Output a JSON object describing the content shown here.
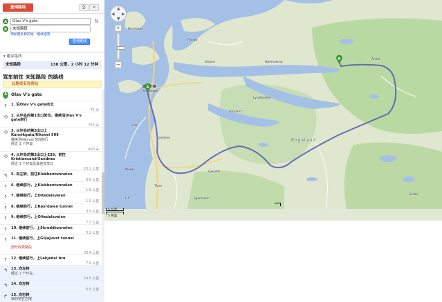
{
  "toolbar": {
    "route_tab": "查询路线",
    "print_icon": "print-icon",
    "link_icon": "link-icon"
  },
  "waypoints": {
    "a_marker": "A",
    "a_value": "Olav V's gate",
    "b_marker": "B",
    "b_value": "未知路段",
    "add_destination": "添加更多目的地 - 路线选项",
    "search_button": "查询路线"
  },
  "route": {
    "suggested_header": "建议路线",
    "summary_name": "未知路段",
    "summary_stats": "138 公里，2 小时 12 分钟",
    "title": "驾车前往 未知路段 的路线",
    "toll_notice": "此路线有收费站",
    "start_marker": "A",
    "start_label": "Olav V's gate"
  },
  "steps": [
    {
      "text": "1. 沿Olav V's gate向北",
      "sub": "",
      "dist": "75 米",
      "icon": "straight-arrow-icon"
    },
    {
      "text": "2. 从环岛的第1出口驶出，继续沿Olav V's gate前行",
      "sub": "",
      "dist": "750 米",
      "icon": "roundabout-icon"
    },
    {
      "text": "3. 从环岛的第3出口上Kannikgata/Riksvei 509",
      "sub": "继续沿Riksvei 509前行\n经过 1 个环岛",
      "dist": "400 米",
      "icon": "roundabout-icon"
    },
    {
      "text": "4. 从环岛的第2出口上E39，前往Kristiansand/Sandnes",
      "sub": "经过 3 个环岛及其他交叉口",
      "dist": "20.2 公里",
      "icon": "roundabout-icon"
    },
    {
      "text": "5. 向左转，前往Klubbentunnelen",
      "sub": "",
      "dist": "0.6 公里",
      "icon": "turn-left-icon"
    },
    {
      "text": "6. 继续前行，上Klubbentunnelen",
      "sub": "",
      "dist": "1.8 公里",
      "icon": "straight-arrow-icon"
    },
    {
      "text": "7. 继续前行，上Oltedalsveien",
      "sub": "",
      "dist": "1.5 公里",
      "icon": "straight-arrow-icon"
    },
    {
      "text": "8. 继续前行，上Røyrdalen tunnel",
      "sub": "",
      "dist": "0.9 公里",
      "icon": "straight-arrow-icon"
    },
    {
      "text": "9. 继续前行，上Oltedalsveien",
      "sub": "",
      "dist": "7.3 公里",
      "icon": "straight-arrow-icon"
    },
    {
      "text": "10. 继续前行，上Skreddtunnelen",
      "sub": "",
      "dist": "0.2 公里",
      "icon": "straight-arrow-icon"
    },
    {
      "text": "11. 继续前行，上Giljajuvet tunnel",
      "sub": "部分收费路段",
      "dist": "33.4 公里",
      "icon": "straight-arrow-icon"
    },
    {
      "text": "12. 继续前行，上Lakjedal bru",
      "sub": "",
      "dist": "7.9 公里",
      "icon": "straight-arrow-icon"
    },
    {
      "text": "13. 向左转",
      "sub": "经过 1 个环岛",
      "dist": "14.6 公里",
      "icon": "turn-left-icon"
    },
    {
      "text": "14. 向左转",
      "sub": "",
      "dist": "0.8 公里",
      "icon": "turn-left-icon"
    },
    {
      "text": "15. 向右转",
      "sub": "目的地在右侧",
      "dist": "2.2 公里",
      "icon": "turn-right-icon"
    }
  ],
  "map": {
    "labels": [
      {
        "text": "Rennesøy",
        "kind": "town"
      },
      {
        "text": "Finnøy",
        "kind": "town"
      },
      {
        "text": "Strand",
        "kind": "town"
      },
      {
        "text": "斯塔万格",
        "kind": "city"
      },
      {
        "text": "Stavanger",
        "kind": "city"
      },
      {
        "text": "Sandnes",
        "kind": "town"
      },
      {
        "text": "Sola",
        "kind": "town"
      },
      {
        "text": "Klepp",
        "kind": "town"
      },
      {
        "text": "Gjesdal",
        "kind": "town"
      },
      {
        "text": "Forsand",
        "kind": "town"
      },
      {
        "text": "Hjelmeland",
        "kind": "town"
      },
      {
        "text": "Sirdal",
        "kind": "town"
      },
      {
        "text": "Bjerkreim",
        "kind": "town"
      },
      {
        "text": "Hå",
        "kind": "town"
      },
      {
        "text": "Time",
        "kind": "town"
      },
      {
        "text": "Årdal",
        "kind": "town"
      },
      {
        "text": "Lysefjorden",
        "kind": "town"
      },
      {
        "text": "Rogaland",
        "kind": "region"
      }
    ],
    "pin_a": "A",
    "pin_b": "B",
    "scale_km": "5 公里",
    "scale_mi": "5 英里",
    "colors": {
      "water": "#a4c0e6",
      "land": "#dfe7cf",
      "forest": "#b8d9a2",
      "route": "#5b5fb0",
      "road_major": "#f6d27a",
      "road_minor": "#ffffff",
      "pin": "#3d9b35"
    }
  }
}
